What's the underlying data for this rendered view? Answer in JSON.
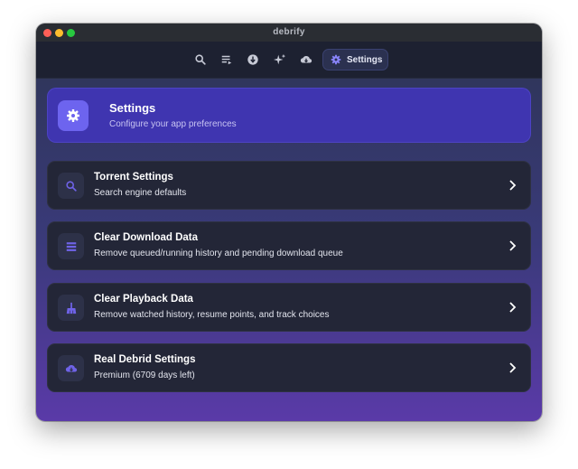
{
  "window": {
    "title": "debrify"
  },
  "toolbar": {
    "icons": [
      "search-icon",
      "queue-list-icon",
      "download-circle-icon",
      "sparkles-icon",
      "cloud-download-icon"
    ],
    "settings_label": "Settings"
  },
  "header": {
    "title": "Settings",
    "subtitle": "Configure your app preferences",
    "icon": "gear-icon",
    "accent": "#3f35b0"
  },
  "rows": [
    {
      "title": "Torrent Settings",
      "subtitle": "Search engine defaults",
      "icon": "search-icon"
    },
    {
      "title": "Clear Download Data",
      "subtitle": "Remove queued/running history and pending download queue",
      "icon": "list-icon"
    },
    {
      "title": "Clear Playback Data",
      "subtitle": "Remove watched history, resume points, and track choices",
      "icon": "broom-icon"
    },
    {
      "title": "Real Debrid Settings",
      "subtitle": "Premium (6709 days left)",
      "icon": "cloud-download-icon"
    }
  ],
  "colors": {
    "icon_accent": "#6f63e8",
    "card_bg": "#232637"
  }
}
